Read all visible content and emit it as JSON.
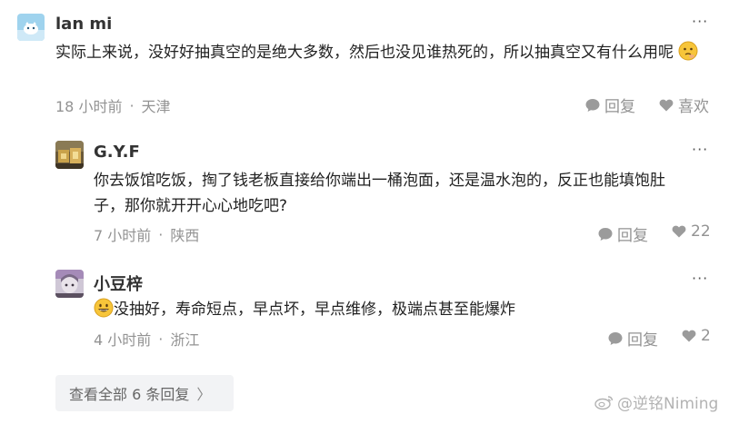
{
  "comment": {
    "username": "lan mi",
    "text": "实际上来说，没好好抽真空的是绝大多数，然后也没见谁热死的，所以抽真空又有什么用呢",
    "emoji": "thinking-face-emoji",
    "time": "18 小时前",
    "location": "天津",
    "reply_label": "回复",
    "like_label": "喜欢"
  },
  "replies": [
    {
      "username": "G.Y.F",
      "text": "你去饭馆吃饭，掏了钱老板直接给你端出一桶泡面，还是温水泡的，反正也能填饱肚子，那你就开开心心地吃吧?",
      "time": "7 小时前",
      "location": "陕西",
      "reply_label": "回复",
      "like_count": "22"
    },
    {
      "username": "小豆梓",
      "emoji": "grinning-face-emoji",
      "text": "没抽好，寿命短点，早点坏，早点维修，极端点甚至能爆炸",
      "time": "4 小时前",
      "location": "浙江",
      "reply_label": "回复",
      "like_count": "2"
    }
  ],
  "show_all_label": "查看全部 6 条回复",
  "more_label": "···",
  "watermark": "@逆铭Niming",
  "colors": {
    "meta": "#939393",
    "text": "#222222",
    "show_all_bg": "#f2f3f5"
  }
}
